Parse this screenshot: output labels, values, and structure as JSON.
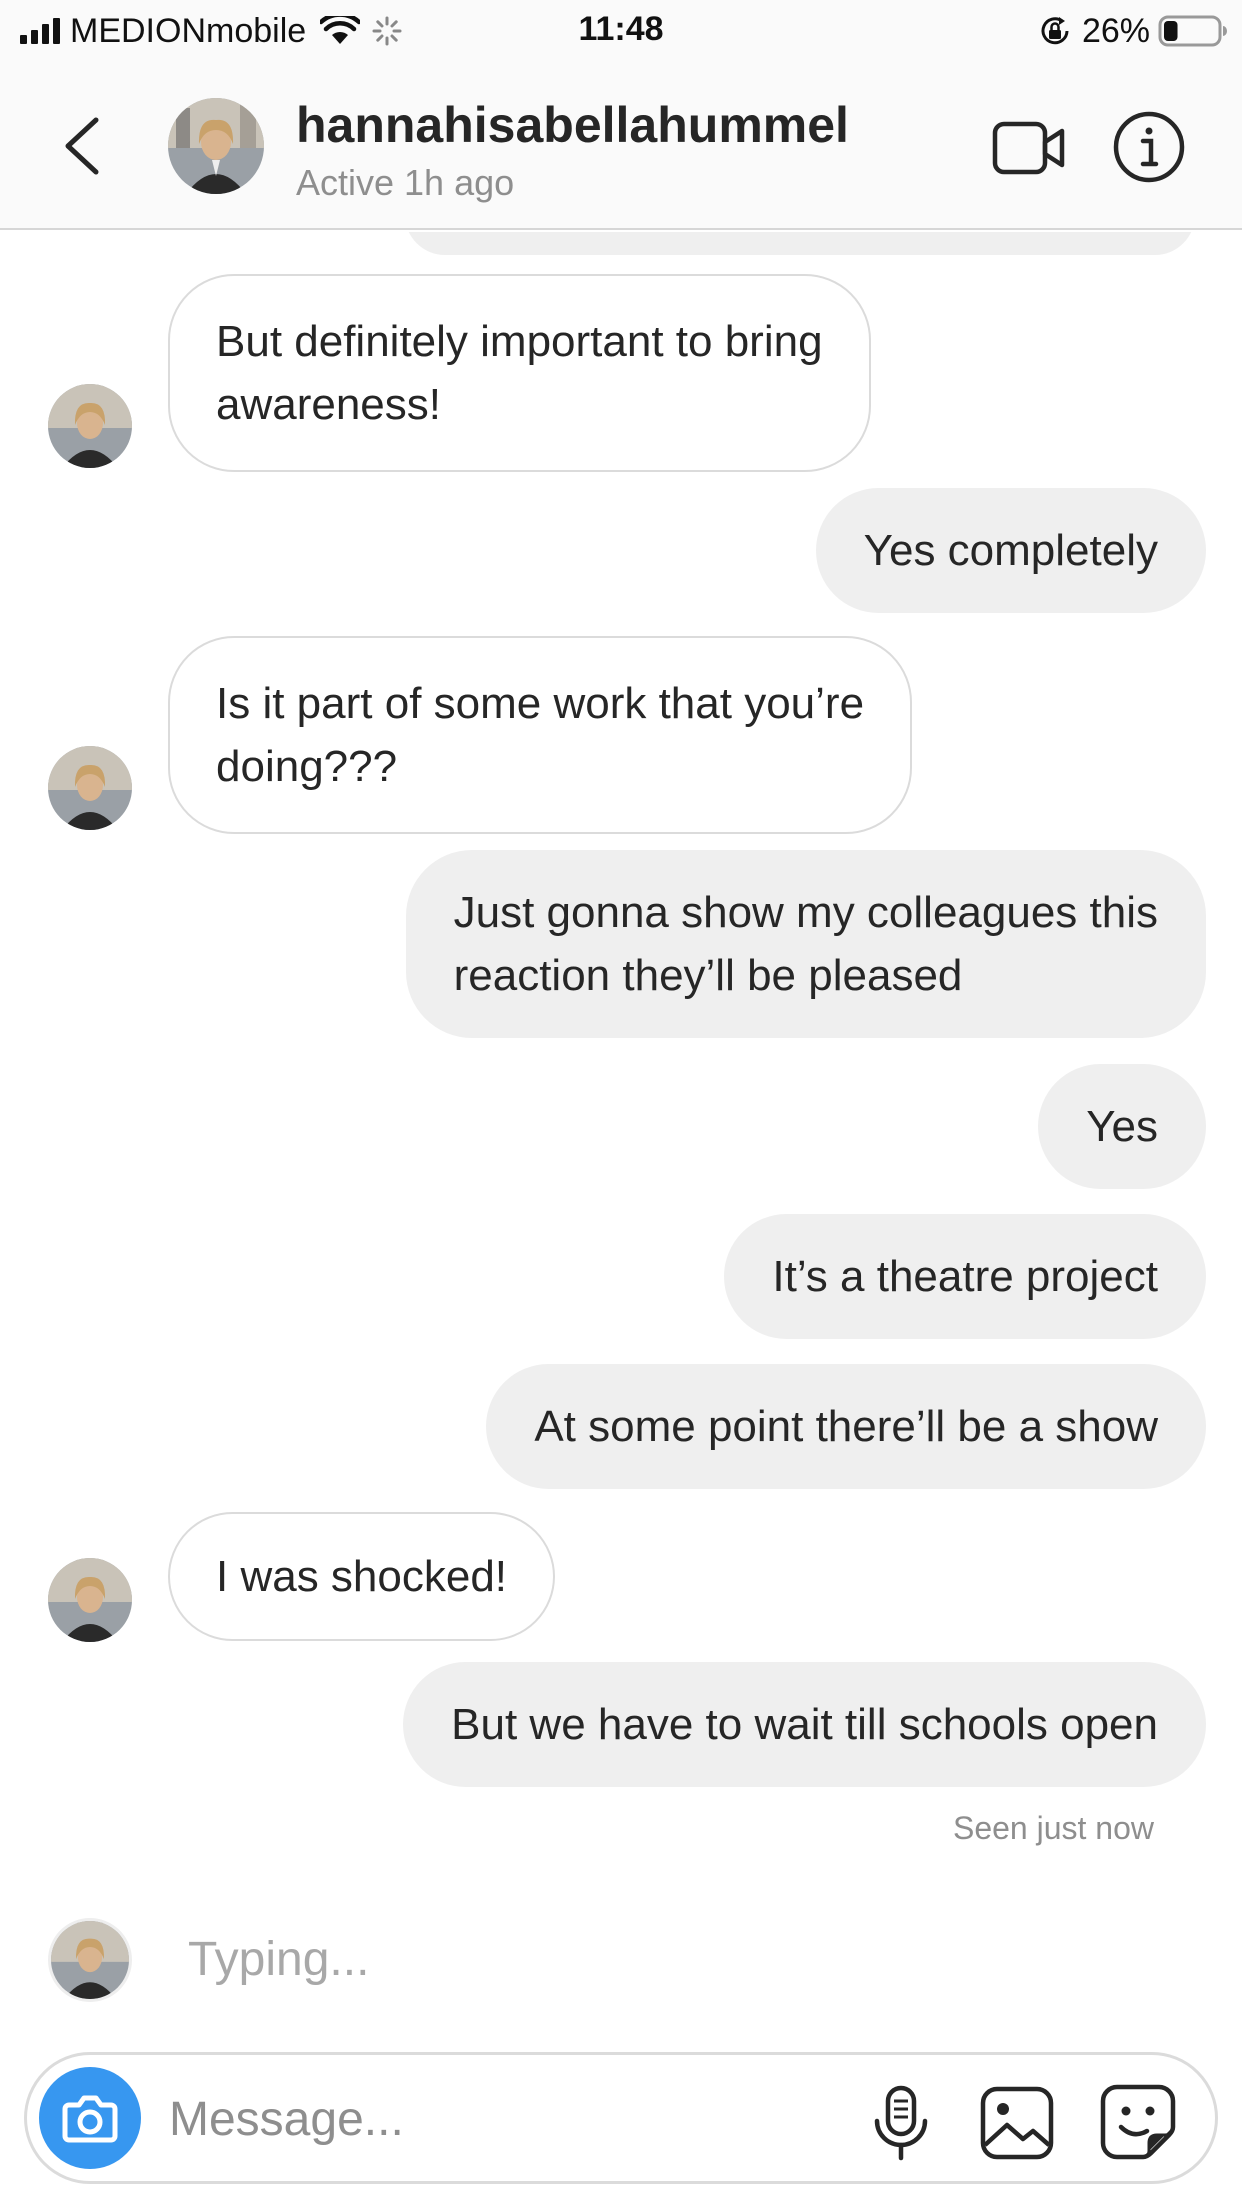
{
  "status_bar": {
    "carrier": "MEDIONmobile",
    "time": "11:48",
    "battery": "26%",
    "battery_level": 0.26,
    "icons": [
      "signal-icon",
      "wifi-icon",
      "activity-spinner-icon",
      "orientation-lock-icon",
      "battery-icon"
    ]
  },
  "header": {
    "username": "hannahisabellahummel",
    "active_status": "Active 1h ago",
    "icons": [
      "chevron-left-icon",
      "profile-avatar",
      "video-camera-icon",
      "info-icon"
    ]
  },
  "messages": [
    {
      "direction": "in",
      "lines": [
        "But definitely important to bring",
        "awareness!"
      ]
    },
    {
      "direction": "out",
      "lines": [
        "Yes completely"
      ]
    },
    {
      "direction": "in",
      "lines": [
        "Is it part of some work that you’re",
        "doing???"
      ]
    },
    {
      "direction": "out",
      "lines": [
        "Just gonna show my colleagues this",
        "reaction they’ll be pleased"
      ]
    },
    {
      "direction": "out",
      "lines": [
        "Yes"
      ]
    },
    {
      "direction": "out",
      "lines": [
        "It’s a theatre project"
      ]
    },
    {
      "direction": "out",
      "lines": [
        "At some point there’ll be a show"
      ]
    },
    {
      "direction": "in",
      "lines": [
        "I was shocked!"
      ]
    },
    {
      "direction": "out",
      "lines": [
        "But we have to wait till schools open"
      ]
    }
  ],
  "seen_status": "Seen just now",
  "typing_indicator": "Typing...",
  "composer": {
    "placeholder": "Message...",
    "icons": [
      "camera-icon",
      "microphone-icon",
      "image-gallery-icon",
      "sticker-icon"
    ]
  },
  "colors": {
    "outgoing_bubble": "#efefef",
    "incoming_border": "#dbdbdb",
    "camera_button": "#3797f0",
    "secondary_text": "#8e8e8e"
  }
}
